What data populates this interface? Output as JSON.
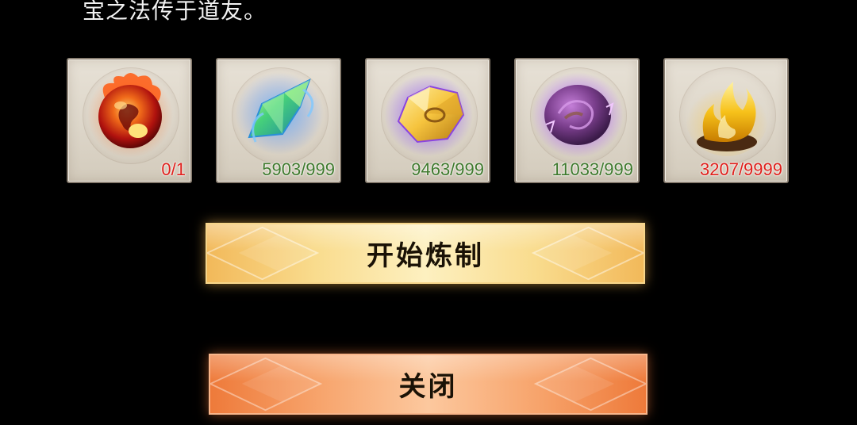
{
  "intro_text": "宝之法传于道友。",
  "materials": [
    {
      "icon": "fire-orb-icon",
      "count": "0/1",
      "count_color": "#e0201c"
    },
    {
      "icon": "green-crystal-icon",
      "count": "5903/999",
      "count_color": "#3f7a2e"
    },
    {
      "icon": "purple-gold-ore-icon",
      "count": "9463/999",
      "count_color": "#3f7a2e"
    },
    {
      "icon": "violet-stone-icon",
      "count": "11033/999",
      "count_color": "#3f7a2e"
    },
    {
      "icon": "golden-flame-icon",
      "count": "3207/9999",
      "count_color": "#e0201c"
    }
  ],
  "buttons": {
    "craft_label": "开始炼制",
    "close_label": "关闭"
  }
}
